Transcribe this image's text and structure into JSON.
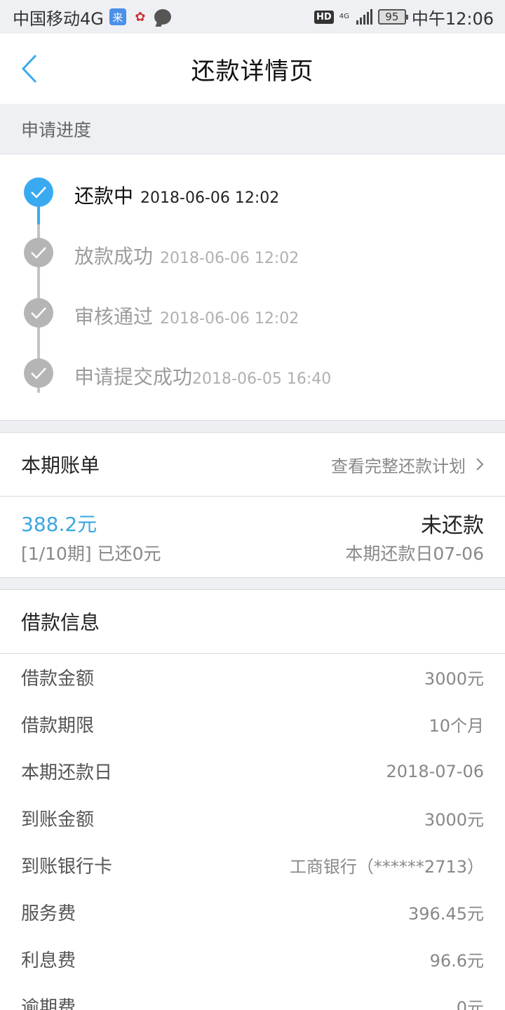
{
  "status_bar": {
    "carrier": "中国移动4G",
    "app_icon_text": "来",
    "battery": "95",
    "time": "中午12:06",
    "hd": "HD",
    "net": "4G"
  },
  "nav": {
    "title": "还款详情页"
  },
  "progress": {
    "header": "申请进度",
    "steps": [
      {
        "label": "还款中",
        "time": "2018-06-06 12:02",
        "state": "active"
      },
      {
        "label": "放款成功",
        "time": "2018-06-06 12:02",
        "state": "done"
      },
      {
        "label": "审核通过",
        "time": "2018-06-06 12:02",
        "state": "done"
      },
      {
        "label": "申请提交成功",
        "time": "2018-06-05 16:40",
        "state": "done"
      }
    ]
  },
  "bill": {
    "title": "本期账单",
    "link": "查看完整还款计划",
    "amount": "388.2元",
    "period": "[1/10期] 已还0元",
    "status": "未还款",
    "due": "本期还款日07-06"
  },
  "loan": {
    "title": "借款信息",
    "rows": [
      {
        "label": "借款金额",
        "value": "3000元"
      },
      {
        "label": "借款期限",
        "value": "10个月"
      },
      {
        "label": "本期还款日",
        "value": "2018-07-06"
      },
      {
        "label": "到账金额",
        "value": "3000元"
      },
      {
        "label": "到账银行卡",
        "value": "工商银行（******2713）"
      },
      {
        "label": "服务费",
        "value": "396.45元"
      },
      {
        "label": "利息费",
        "value": "96.6元"
      },
      {
        "label": "逾期费",
        "value": "0元"
      }
    ]
  },
  "colors": {
    "accent": "#3aaaf0",
    "amount": "#3aa6e0",
    "inactive": "#b5b5b5",
    "background": "#eef0f3"
  }
}
